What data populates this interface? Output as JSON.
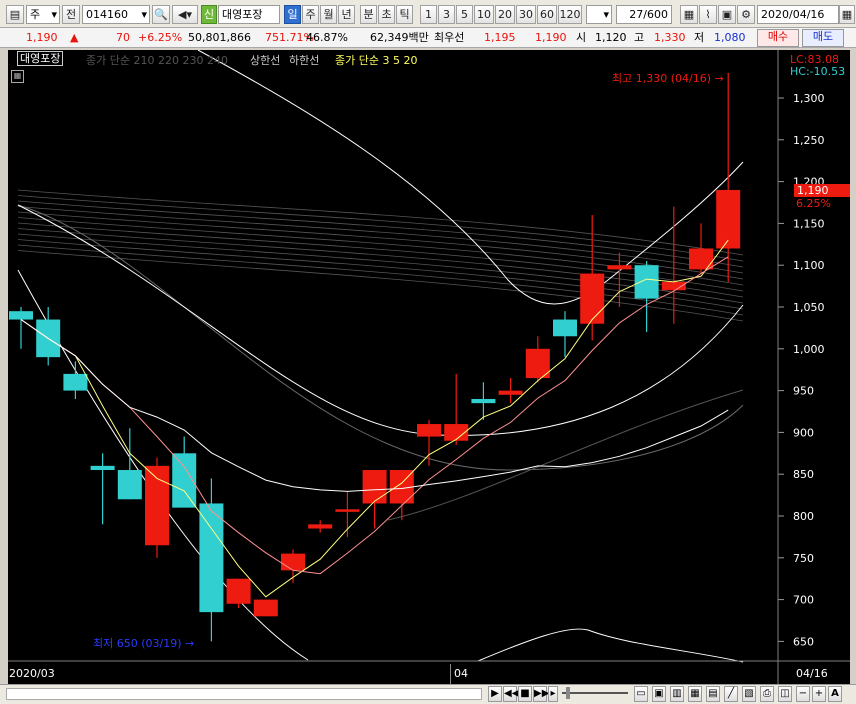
{
  "toolbar": {
    "period_mode": "주",
    "prev_label": "전",
    "stock_code": "014160",
    "tag_new": "신",
    "stock_name": "대영포장",
    "tabs": [
      {
        "label": "일",
        "active": true
      },
      {
        "label": "주",
        "active": false
      },
      {
        "label": "월",
        "active": false
      },
      {
        "label": "년",
        "active": false
      },
      {
        "label": "분",
        "active": false
      },
      {
        "label": "초",
        "active": false
      },
      {
        "label": "틱",
        "active": false
      }
    ],
    "intervals": [
      "1",
      "3",
      "5",
      "10",
      "20",
      "30",
      "60",
      "120"
    ],
    "count": "27/600",
    "date": "2020/04/16"
  },
  "info": {
    "price": "1,190",
    "change": "70",
    "change_pct": "+6.25%",
    "volume": "50,801,866",
    "vol_ratio": "751.71%",
    "turnover": "46.87%",
    "amount": "62,349백만",
    "ask_label": "최우선",
    "ask1": "1,195",
    "bid1": "1,190",
    "open_label": "시",
    "open": "1,120",
    "high_label": "고",
    "high": "1,330",
    "low_label": "저",
    "low": "1,080",
    "buy_label": "매수",
    "sell_label": "매도"
  },
  "chart": {
    "legend_name": "대영포장",
    "legend_ma_text": "종가 단순 210  220  230  240",
    "legend_limit_up": "상한선",
    "legend_limit_down": "하한선",
    "legend_ma2": "종가 단순 3  5  20",
    "lc_label": "LC:83.08",
    "hc_label": "HC:-10.53",
    "current_price_tag": "1,190",
    "current_pct_tag": "6.25%",
    "max_annotation": "최고 1,330 (04/16) →",
    "min_annotation": "최저 650 (03/19) →",
    "x_labels": [
      "2020/03",
      "04",
      "04/16"
    ],
    "colors": {
      "up": "#ee1b10",
      "down": "#32cfd0",
      "ma3": "#ffff80",
      "ma5": "#ff9090",
      "ma20": "#ffffff"
    }
  },
  "chart_data": {
    "type": "candlestick",
    "yticks": [
      650,
      700,
      750,
      800,
      850,
      900,
      950,
      1000,
      1050,
      1100,
      1150,
      1200,
      1250,
      1300
    ],
    "ylim": [
      620,
      1350
    ],
    "candles": [
      {
        "o": 1045,
        "h": 1050,
        "l": 1000,
        "c": 1035
      },
      {
        "o": 1035,
        "h": 1050,
        "l": 980,
        "c": 990
      },
      {
        "o": 970,
        "h": 985,
        "l": 940,
        "c": 950
      },
      {
        "o": 860,
        "h": 875,
        "l": 790,
        "c": 855
      },
      {
        "o": 855,
        "h": 905,
        "l": 820,
        "c": 820
      },
      {
        "o": 765,
        "h": 870,
        "l": 750,
        "c": 860
      },
      {
        "o": 875,
        "h": 895,
        "l": 810,
        "c": 810
      },
      {
        "o": 815,
        "h": 845,
        "l": 650,
        "c": 685
      },
      {
        "o": 695,
        "h": 725,
        "l": 690,
        "c": 725
      },
      {
        "o": 680,
        "h": 700,
        "l": 680,
        "c": 700
      },
      {
        "o": 735,
        "h": 760,
        "l": 720,
        "c": 755
      },
      {
        "o": 785,
        "h": 795,
        "l": 780,
        "c": 790
      },
      {
        "o": 805,
        "h": 830,
        "l": 775,
        "c": 808
      },
      {
        "o": 815,
        "h": 855,
        "l": 785,
        "c": 855
      },
      {
        "o": 815,
        "h": 855,
        "l": 795,
        "c": 855
      },
      {
        "o": 895,
        "h": 915,
        "l": 860,
        "c": 910
      },
      {
        "o": 890,
        "h": 970,
        "l": 885,
        "c": 910
      },
      {
        "o": 940,
        "h": 960,
        "l": 915,
        "c": 935
      },
      {
        "o": 945,
        "h": 965,
        "l": 935,
        "c": 950
      },
      {
        "o": 965,
        "h": 1015,
        "l": 960,
        "c": 1000
      },
      {
        "o": 1035,
        "h": 1045,
        "l": 990,
        "c": 1015
      },
      {
        "o": 1030,
        "h": 1160,
        "l": 1010,
        "c": 1090
      },
      {
        "o": 1095,
        "h": 1115,
        "l": 1050,
        "c": 1100
      },
      {
        "o": 1100,
        "h": 1105,
        "l": 1020,
        "c": 1060
      },
      {
        "o": 1070,
        "h": 1170,
        "l": 1030,
        "c": 1080
      },
      {
        "o": 1095,
        "h": 1150,
        "l": 1090,
        "c": 1120
      },
      {
        "o": 1120,
        "h": 1330,
        "l": 1080,
        "c": 1190
      }
    ]
  }
}
